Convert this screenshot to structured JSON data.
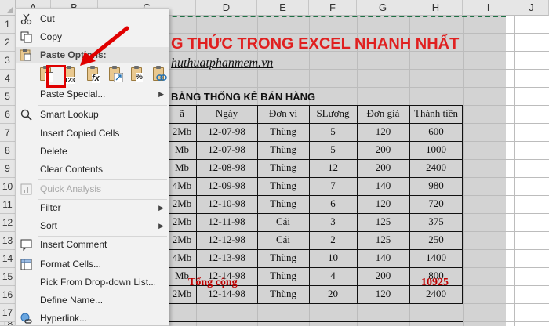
{
  "columns": [
    "A",
    "B",
    "C",
    "D",
    "E",
    "F",
    "G",
    "H",
    "I",
    "J"
  ],
  "rows": [
    "1",
    "2",
    "3",
    "4",
    "5",
    "6",
    "7",
    "8",
    "9",
    "10",
    "11",
    "12",
    "13",
    "14",
    "15",
    "16",
    "17",
    "18"
  ],
  "sheet": {
    "title_partial": "G THỨC TRONG EXCEL NHANH NHẤT",
    "site_partial": "huthuatphanmem.vn",
    "table_title_partial": "BẢNG THỐNG KÊ BÁN HÀNG",
    "headers": [
      "ã",
      "Ngày",
      "Đơn vị",
      "SLượng",
      "Đơn giá",
      "Thành tiền"
    ],
    "table_rows": [
      [
        "2Mb",
        "12-07-98",
        "Thùng",
        "5",
        "120",
        "600"
      ],
      [
        "Mb",
        "12-07-98",
        "Thùng",
        "5",
        "200",
        "1000"
      ],
      [
        "Mb",
        "12-08-98",
        "Thùng",
        "12",
        "200",
        "2400"
      ],
      [
        "4Mb",
        "12-09-98",
        "Thùng",
        "7",
        "140",
        "980"
      ],
      [
        "2Mb",
        "12-10-98",
        "Thùng",
        "6",
        "120",
        "720"
      ],
      [
        "2Mb",
        "12-11-98",
        "Cái",
        "3",
        "125",
        "375"
      ],
      [
        "2Mb",
        "12-12-98",
        "Cái",
        "2",
        "125",
        "250"
      ],
      [
        "4Mb",
        "12-13-98",
        "Thùng",
        "10",
        "140",
        "1400"
      ],
      [
        "Mb",
        "12-14-98",
        "Thùng",
        "4",
        "200",
        "800"
      ],
      [
        "2Mb",
        "12-14-98",
        "Thùng",
        "20",
        "120",
        "2400"
      ]
    ],
    "total_label": "Tổng cộng",
    "total_value": "10925"
  },
  "menu": {
    "cut": "Cut",
    "copy": "Copy",
    "paste_options": "Paste Options:",
    "paste_values_label": "123",
    "paste_formula_label": "fx",
    "paste_percent_label": "%",
    "paste_special": "Paste Special...",
    "smart_lookup": "Smart Lookup",
    "insert_copied_cells": "Insert Copied Cells",
    "delete": "Delete",
    "clear_contents": "Clear Contents",
    "quick_analysis": "Quick Analysis",
    "filter": "Filter",
    "sort": "Sort",
    "insert_comment": "Insert Comment",
    "format_cells": "Format Cells...",
    "pick_from_dropdown": "Pick From Drop-down List...",
    "define_name": "Define Name...",
    "hyperlink": "Hyperlink..."
  },
  "colors": {
    "title_red": "#e02020",
    "highlight_red": "#e00000",
    "total_red": "#c00000",
    "marquee_green": "#1e7145",
    "selection_gray": "#d3d3d3",
    "menu_bg": "#f2f2f2"
  }
}
